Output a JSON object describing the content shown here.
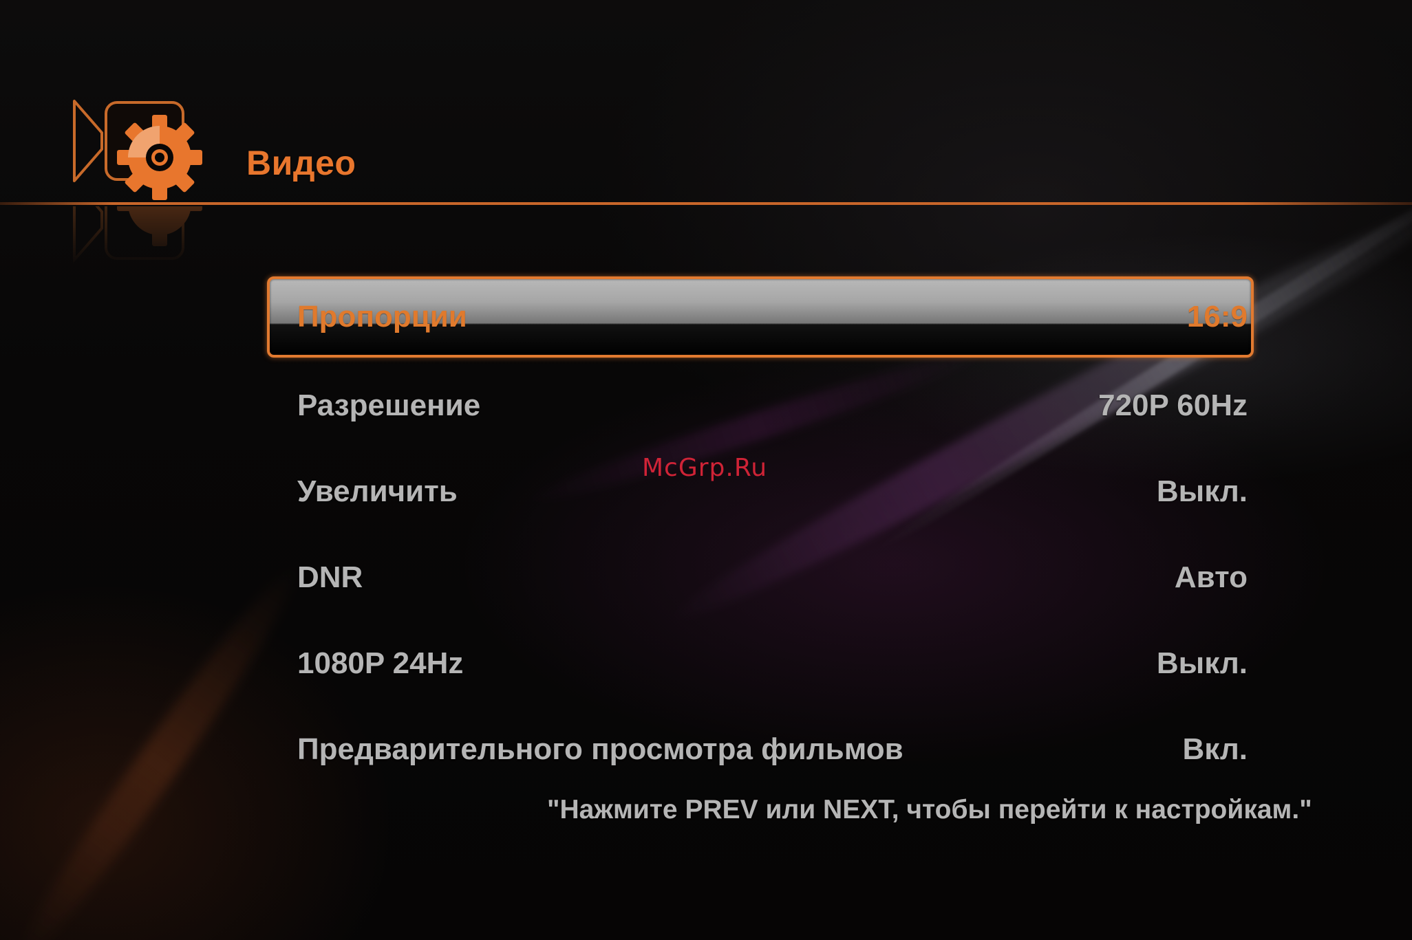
{
  "header": {
    "title": "Видео",
    "icon": "video-settings-icon"
  },
  "menu": {
    "items": [
      {
        "label": "Пропорции",
        "value": "16:9",
        "selected": true
      },
      {
        "label": "Разрешение",
        "value": "720P 60Hz",
        "selected": false
      },
      {
        "label": "Увеличить",
        "value": "Выкл.",
        "selected": false
      },
      {
        "label": "DNR",
        "value": "Авто",
        "selected": false
      },
      {
        "label": "1080P 24Hz",
        "value": "Выкл.",
        "selected": false
      },
      {
        "label": "Предварительного просмотра фильмов",
        "value": "Вкл.",
        "selected": false
      }
    ]
  },
  "hint": "\"Нажмите PREV или NEXT, чтобы перейти к настройкам.\"",
  "watermark": "McGrp.Ru",
  "colors": {
    "accent": "#e27a30",
    "text": "#b5b5b5",
    "background": "#070606",
    "watermark": "#e0263a"
  }
}
